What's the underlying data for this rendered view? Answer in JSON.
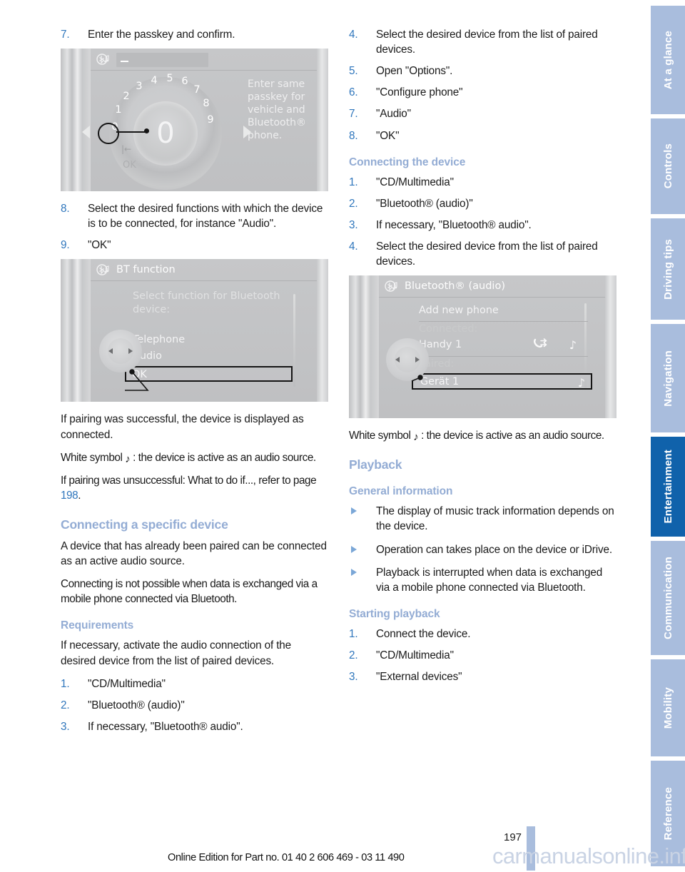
{
  "document": {
    "page_number": "197",
    "footer_note": "Online Edition for Part no. 01 40 2 606 469 - 03 11 490",
    "watermark": "carmanualsonline.info"
  },
  "colors": {
    "heading_blue": "#93acd4",
    "number_blue": "#2f76bc",
    "tab_inactive": "#a9bddd",
    "tab_active": "#1062ab"
  },
  "tabs": [
    {
      "label": "At a glance",
      "active": false
    },
    {
      "label": "Controls",
      "active": false
    },
    {
      "label": "Driving tips",
      "active": false
    },
    {
      "label": "Navigation",
      "active": false
    },
    {
      "label": "Entertainment",
      "active": true
    },
    {
      "label": "Communication",
      "active": false
    },
    {
      "label": "Mobility",
      "active": false
    },
    {
      "label": "Reference",
      "active": false
    }
  ],
  "left_column": {
    "step7": {
      "num": "7.",
      "text": "Enter the passkey and confirm."
    },
    "figure_passkey": {
      "title_icon": "bluetooth-audio-icon",
      "input_value": "_",
      "hint": "Enter same passkey for vehicle and Bluetooth® phone.",
      "dial_numbers": [
        "0",
        "1",
        "2",
        "3",
        "4",
        "5",
        "6",
        "7",
        "8",
        "9"
      ],
      "selected_number": "0",
      "center_value": "0",
      "ok_label": "OK",
      "back_label": "|←"
    },
    "step8": {
      "num": "8.",
      "text": "Select the desired functions with which the device is to be connected, for instance \"Audio\"."
    },
    "step9": {
      "num": "9.",
      "text": "\"OK\""
    },
    "figure_bt_function": {
      "title": "BT function",
      "prompt": "Select function for Bluetooth device:",
      "options": [
        {
          "label": "Telephone",
          "checked": true
        },
        {
          "label": "Audio",
          "checked": true
        }
      ],
      "confirm_label": "OK"
    },
    "para_success": "If pairing was successful, the device is displayed as connected.",
    "para_white_symbol_pre": "White symbol ",
    "para_white_symbol_post": " : the device is active as an audio source.",
    "para_unsuccessful_pre": "If pairing was unsuccessful: What to do if..., refer to page ",
    "para_unsuccessful_ref": "198",
    "para_unsuccessful_post": ".",
    "heading_connecting_specific": "Connecting a specific device",
    "para_paired_device": "A device that has already been paired can be connected as an active audio source.",
    "para_not_possible": "Connecting is not possible when data is exchanged via a mobile phone connected via Bluetooth.",
    "heading_requirements": "Requirements",
    "para_requirements": "If necessary, activate the audio connection of the desired device from the list of paired devices.",
    "req_steps": [
      {
        "num": "1.",
        "text": "\"CD/Multimedia\""
      },
      {
        "num": "2.",
        "text": "\"Bluetooth® (audio)\""
      },
      {
        "num": "3.",
        "text": "If necessary, \"Bluetooth® audio\"."
      }
    ]
  },
  "right_column": {
    "cont_steps": [
      {
        "num": "4.",
        "text": "Select the desired device from the list of paired devices."
      },
      {
        "num": "5.",
        "text": "Open \"Options\"."
      },
      {
        "num": "6.",
        "text": "\"Configure phone\""
      },
      {
        "num": "7.",
        "text": "\"Audio\""
      },
      {
        "num": "8.",
        "text": "\"OK\""
      }
    ],
    "heading_connecting_device": "Connecting the device",
    "connect_steps": [
      {
        "num": "1.",
        "text": "\"CD/Multimedia\""
      },
      {
        "num": "2.",
        "text": "\"Bluetooth® (audio)\""
      },
      {
        "num": "3.",
        "text": "If necessary, \"Bluetooth® audio\"."
      },
      {
        "num": "4.",
        "text": "Select the desired device from the list of paired devices."
      }
    ],
    "figure_bt_audio": {
      "title": "Bluetooth® (audio)",
      "add_new": "Add new phone",
      "connected_label": "Connected:",
      "connected_device": "Handy 1",
      "paired_label": "Paired:",
      "paired_device": "Gerät 1"
    },
    "para_white_symbol_pre": "White symbol ",
    "para_white_symbol_post": " : the device is active as an audio source.",
    "heading_playback": "Playback",
    "heading_general_info": "General information",
    "general_bullets": [
      "The display of music track information depends on the device.",
      "Operation can takes place on the device or iDrive.",
      "Playback is interrupted when data is exchanged via a mobile phone connected via Bluetooth."
    ],
    "heading_starting_playback": "Starting playback",
    "playback_steps": [
      {
        "num": "1.",
        "text": "Connect the device."
      },
      {
        "num": "2.",
        "text": "\"CD/Multimedia\""
      },
      {
        "num": "3.",
        "text": "\"External devices\""
      }
    ]
  }
}
